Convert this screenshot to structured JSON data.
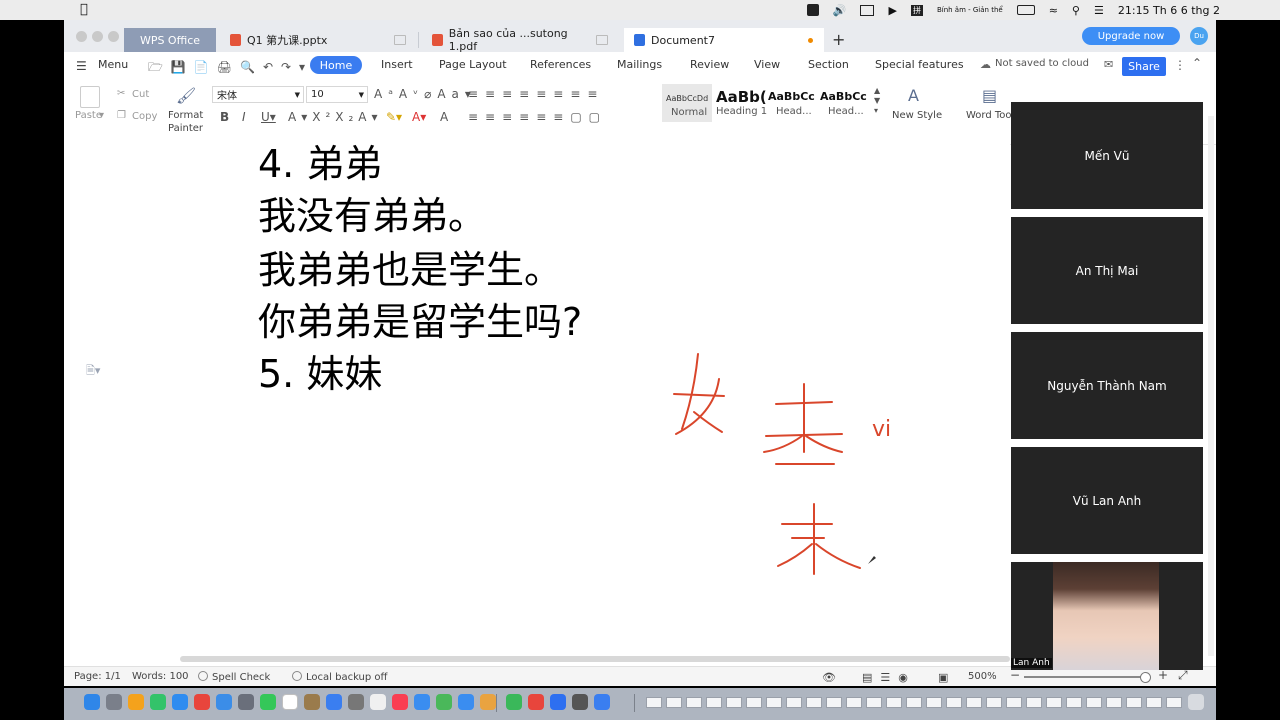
{
  "menubar": {
    "ime_label": "Bính âm - Giản thể",
    "clock": "21:15 Th 6 6 thg 2"
  },
  "tabs": {
    "home_app": "WPS Office",
    "pptx": "Q1 第九课.pptx",
    "pdf": "Bản sao của ...sutong 1.pdf",
    "doc": "Document7"
  },
  "header": {
    "upgrade": "Upgrade now",
    "avatar_text": "Du"
  },
  "ribbon": {
    "menu": "Menu",
    "tabs": [
      "Home",
      "Insert",
      "Page Layout",
      "References",
      "Mailings",
      "Review",
      "View",
      "Section",
      "Special features"
    ],
    "cloud_status": "Not saved to cloud",
    "share": "Share"
  },
  "toolbar": {
    "paste": "Paste",
    "cut": "Cut",
    "copy": "Copy",
    "format_painter_1": "Format",
    "format_painter_2": "Painter",
    "font_name": "宋体",
    "font_size": "10",
    "styles": [
      {
        "preview": "AaBbCcDd",
        "name": "Normal"
      },
      {
        "preview": "AaBb(",
        "name": "Heading 1"
      },
      {
        "preview": "AaBbCc",
        "name": "Head..."
      },
      {
        "preview": "AaBbCc",
        "name": "Head..."
      }
    ],
    "new_style": "New Style",
    "word_tools": "Word Tool"
  },
  "document": {
    "lines": [
      "4. 弟弟",
      "我没有弟弟。",
      "我弟弟也是学生。",
      "你弟弟是留学生吗?",
      "5. 妹妹"
    ],
    "handwriting_note": "vi"
  },
  "status": {
    "page": "Page: 1/1",
    "words": "Words: 100",
    "spell": "Spell Check",
    "backup": "Local backup off",
    "zoom": "500%"
  },
  "participants": [
    "Mến Vũ",
    "An Thị Mai",
    "Nguyễn Thành Nam",
    "Vũ Lan Anh",
    "Lan Anh"
  ],
  "colors": {
    "accent": "#3a7cf0",
    "ink": "#d9462b",
    "tile": "#242424"
  }
}
